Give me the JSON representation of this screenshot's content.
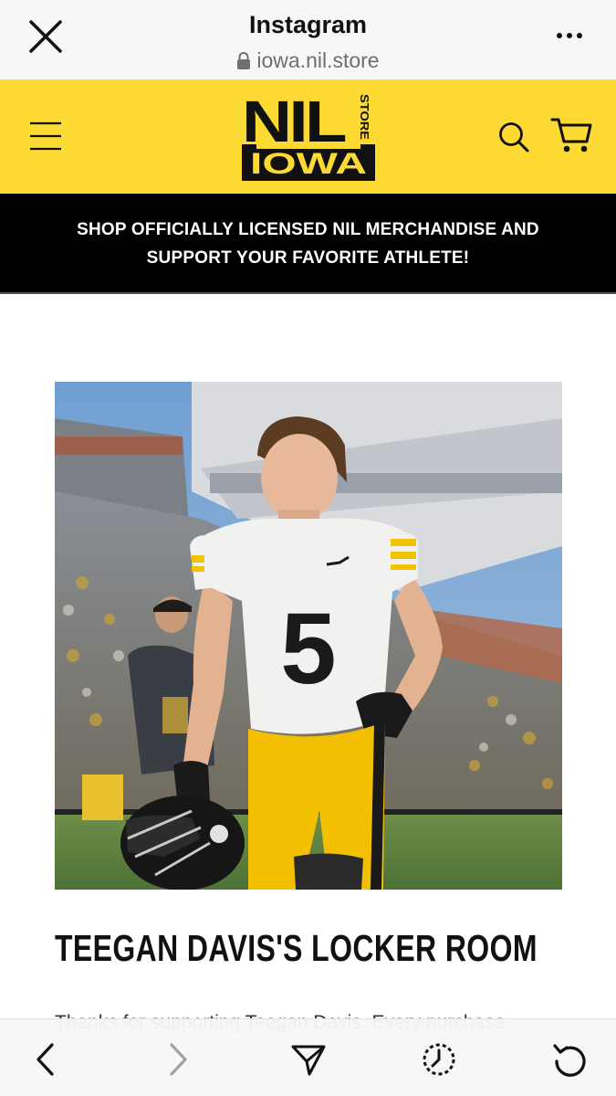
{
  "browser": {
    "title": "Instagram",
    "url": "iowa.nil.store",
    "icons": [
      "close-icon",
      "lock-icon",
      "more-icon"
    ]
  },
  "header": {
    "logo": {
      "line1": "NIL",
      "store": "STORE",
      "line2": "IOWA"
    },
    "brand_color": "#fcd933",
    "icons": [
      "hamburger-menu-icon",
      "search-icon",
      "cart-icon"
    ]
  },
  "banner": {
    "text": "SHOP OFFICIALLY LICENSED NIL MERCHANDISE AND SUPPORT YOUR FAVORITE ATHLETE!"
  },
  "main": {
    "hero_image": {
      "jersey_number": "5"
    },
    "title": "TEEGAN DAVIS'S LOCKER ROOM",
    "intro_text": "Thanks for supporting Teegan Davis. Every purchase"
  },
  "bottom_nav": {
    "icons": [
      "back-icon",
      "forward-icon",
      "share-icon",
      "history-icon",
      "reload-icon"
    ]
  }
}
